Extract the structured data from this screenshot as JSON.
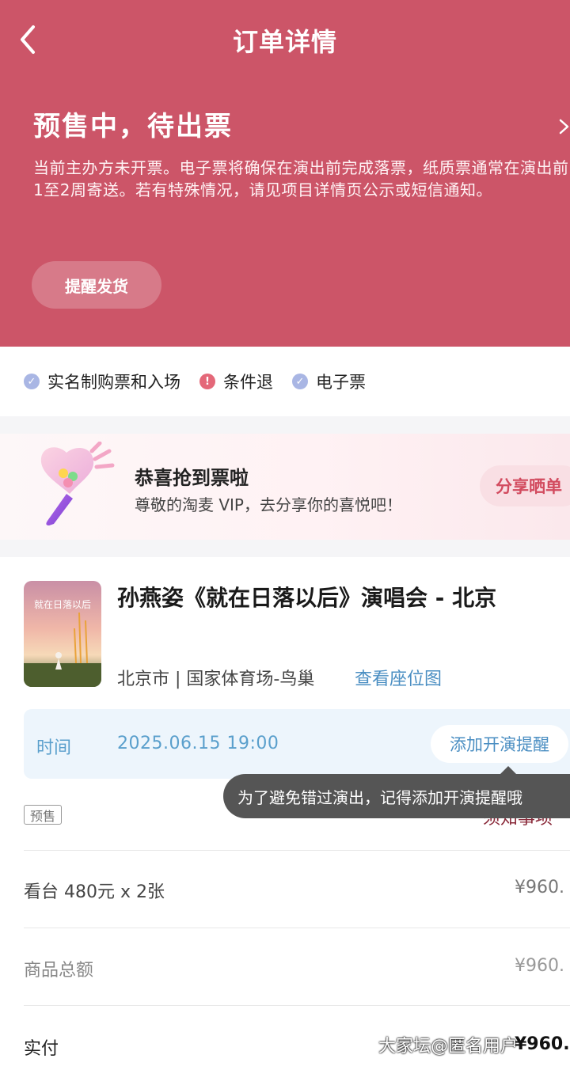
{
  "nav": {
    "title": "订单详情"
  },
  "status": {
    "title": "预售中，待出票",
    "description": "当前主办方未开票。电子票将确保在演出前完成落票，纸质票通常在演出前1至2周寄送。若有特殊情况，请见项目详情页公示或短信通知。",
    "remind_button": "提醒发货"
  },
  "tags": [
    {
      "label": "实名制购票和入场",
      "icon": "check-icon"
    },
    {
      "label": "条件退",
      "icon": "exclamation-icon"
    },
    {
      "label": "电子票",
      "icon": "check-icon"
    }
  ],
  "banner": {
    "title": "恭喜抢到票啦",
    "subtitle": "尊敬的淘麦 VIP，去分享你的喜悦吧！",
    "share_button": "分享晒单"
  },
  "show": {
    "title": "孙燕姿《就在日落以后》演唱会 - 北京",
    "poster_text": "就在日落以后",
    "venue": "北京市 | 国家体育场-鸟巢",
    "seat_map_link": "查看座位图",
    "time_label": "时间",
    "time_value": "2025.06.15 19:00",
    "add_reminder": "添加开演提醒",
    "tooltip": "为了避免错过演出，记得添加开演提醒哦",
    "notice": "须知事项",
    "badge": "预售"
  },
  "price_rows": [
    {
      "label": "看台 480元 x 2张",
      "value": "¥960."
    },
    {
      "label": "商品总额",
      "value": "¥960."
    },
    {
      "label": "实付",
      "value": "¥960."
    }
  ],
  "watermark": "大家坛@匿名用户",
  "colors": {
    "accent": "#cc5568",
    "link": "#4a8ec2",
    "tag_ok": "#a9b6e4",
    "tag_warn": "#e46879"
  }
}
